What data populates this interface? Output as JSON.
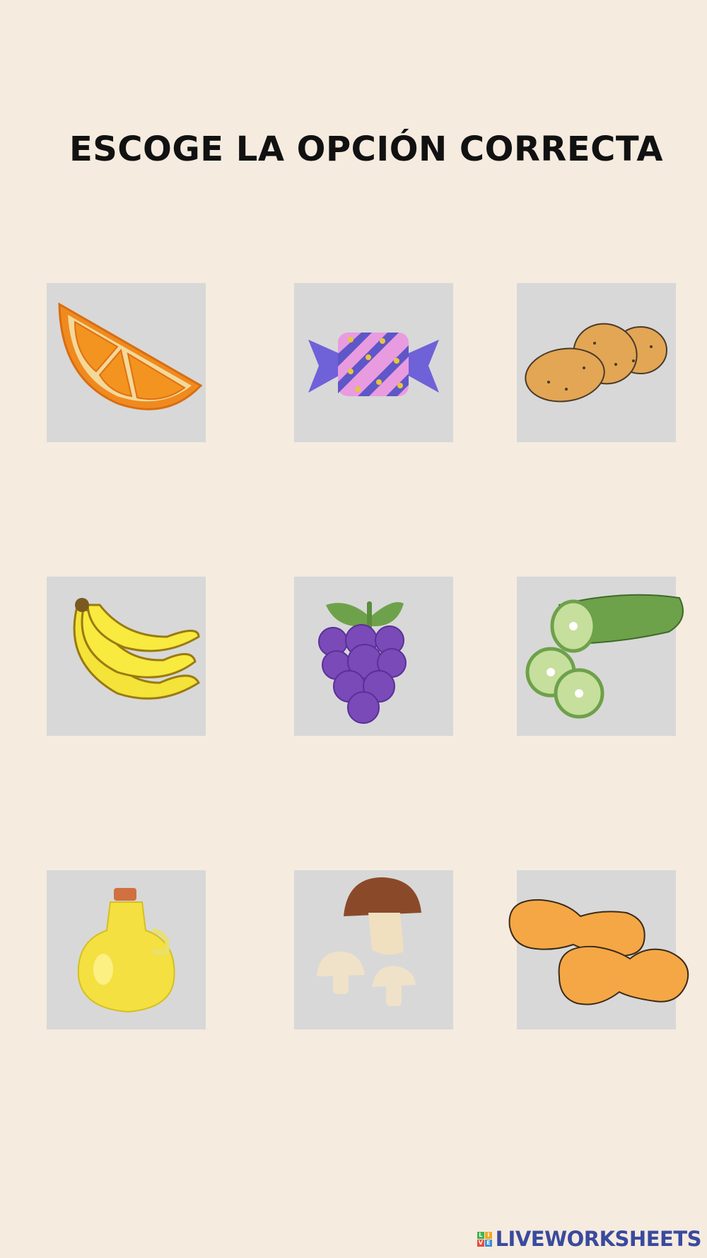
{
  "title": "ESCOGE LA OPCIÓN CORRECTA",
  "brand": {
    "text": "LIVEWORKSHEETS",
    "logo_letters": [
      "L",
      "I",
      "V",
      "E"
    ]
  },
  "colors": {
    "background": "#f5ebdf",
    "tile": "#d8d8d8",
    "brand": "#3a4a9e"
  },
  "options": [
    {
      "icon": "orange-slice-icon"
    },
    {
      "icon": "candy-icon"
    },
    {
      "icon": "potatoes-icon"
    },
    {
      "icon": "bananas-icon"
    },
    {
      "icon": "grapes-icon"
    },
    {
      "icon": "cucumber-icon"
    },
    {
      "icon": "oil-bottle-icon"
    },
    {
      "icon": "mushrooms-icon"
    },
    {
      "icon": "peanuts-icon"
    }
  ]
}
